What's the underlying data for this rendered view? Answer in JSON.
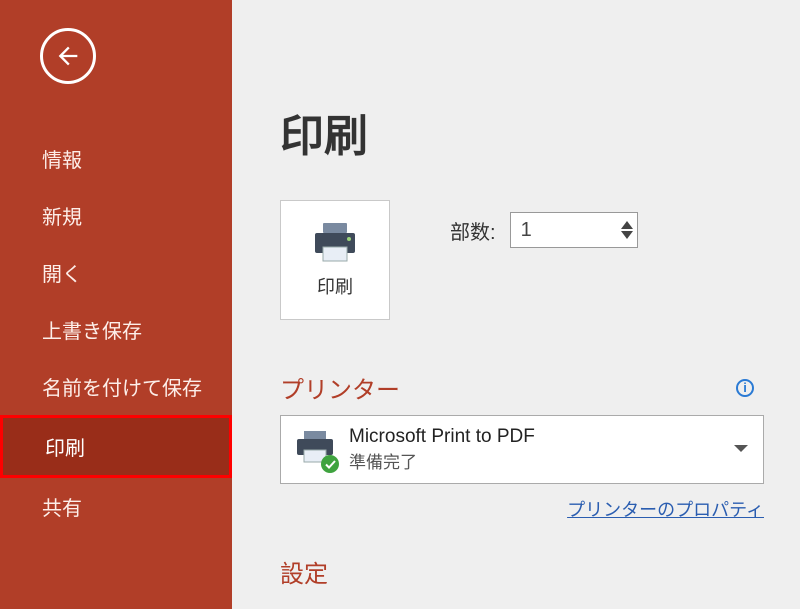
{
  "sidebar": {
    "items": [
      {
        "label": "情報"
      },
      {
        "label": "新規"
      },
      {
        "label": "開く"
      },
      {
        "label": "上書き保存"
      },
      {
        "label": "名前を付けて保存"
      },
      {
        "label": "印刷"
      },
      {
        "label": "共有"
      }
    ],
    "active_index": 5
  },
  "page": {
    "title": "印刷"
  },
  "print_button": {
    "label": "印刷"
  },
  "copies": {
    "label": "部数:",
    "value": "1"
  },
  "printer": {
    "section_title": "プリンター",
    "name": "Microsoft Print to PDF",
    "status": "準備完了",
    "properties_link": "プリンターのプロパティ"
  },
  "settings": {
    "section_title": "設定"
  }
}
